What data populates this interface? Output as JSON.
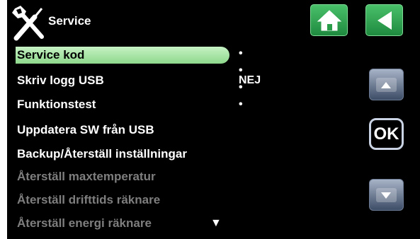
{
  "header": {
    "title": "Service",
    "icons": {
      "tools": "tools-icon",
      "home": "home-icon",
      "back": "back-icon"
    },
    "accent": "#2fa64e"
  },
  "menu": {
    "items": [
      {
        "label": "Service kod",
        "value": "• • • •",
        "selected": true,
        "enabled": true
      },
      {
        "label": "Skriv logg USB",
        "value": "NEJ",
        "enabled": true
      },
      {
        "label": "Funktionstest",
        "enabled": true
      },
      {
        "label": "Uppdatera SW från USB",
        "enabled": true
      },
      {
        "label": "Backup/Återställ inställningar",
        "enabled": true
      },
      {
        "label": "Återställ maxtemperatur",
        "enabled": false
      },
      {
        "label": "Återställ drifttids räknare",
        "enabled": false
      },
      {
        "label": "Återställ energi räknare",
        "enabled": false
      }
    ],
    "more_indicator": "▼"
  },
  "sidebar": {
    "up_icon": "scroll-up-icon",
    "ok_label": "OK",
    "down_icon": "scroll-down-icon"
  }
}
